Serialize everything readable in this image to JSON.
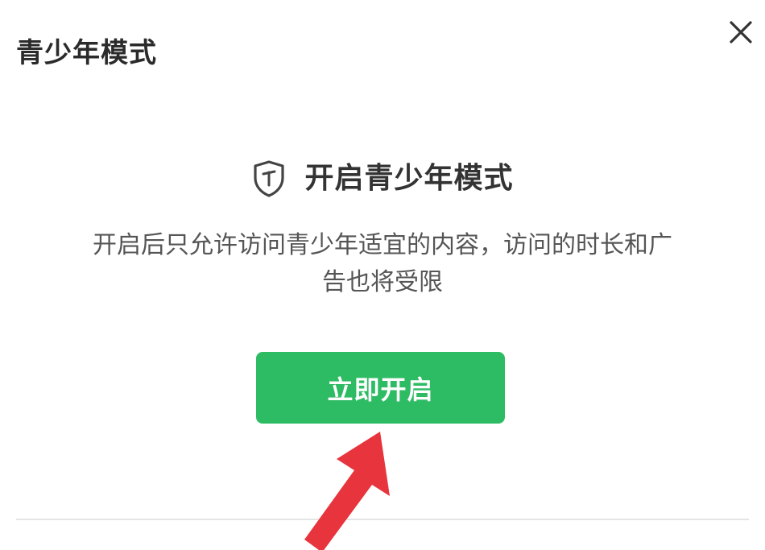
{
  "dialog": {
    "title": "青少年模式",
    "close_icon": "close-icon"
  },
  "content": {
    "shield_icon": "shield-icon",
    "heading": "开启青少年模式",
    "description": "开启后只允许访问青少年适宜的内容，访问的时长和广告也将受限",
    "primary_button_label": "立即开启"
  },
  "annotation": {
    "arrow_icon": "red-arrow-icon",
    "arrow_color": "#e8343c"
  },
  "colors": {
    "accent": "#2dbc63",
    "title_text": "#2b2b2b",
    "body_text": "#555555"
  }
}
